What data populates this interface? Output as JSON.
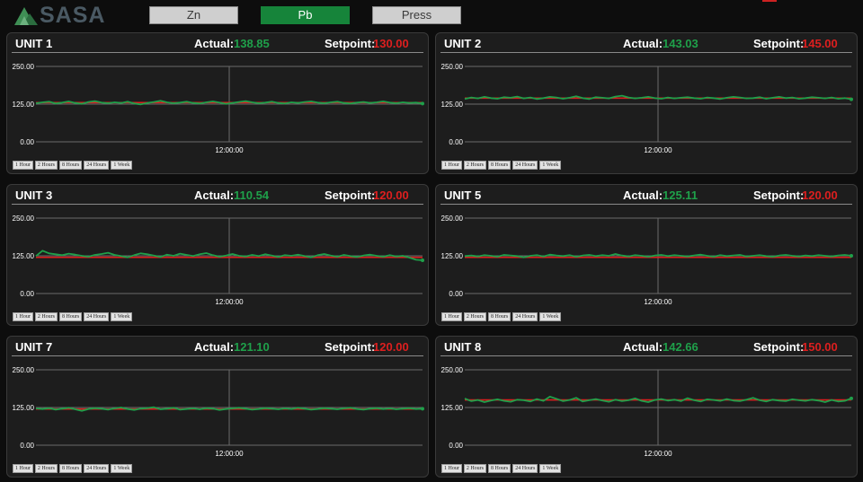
{
  "header": {
    "logo_text": "SASA",
    "tabs": [
      {
        "label": "Zn",
        "active": false
      },
      {
        "label": "Pb",
        "active": true
      },
      {
        "label": "Press",
        "active": false
      }
    ]
  },
  "labels": {
    "actual": "Actual:",
    "setpoint": "Setpoint:"
  },
  "colors": {
    "actual": "#1fa04a",
    "setpoint": "#dd1f1f",
    "active_tab": "#16843a"
  },
  "chart_common": {
    "type": "line",
    "ylim": [
      0,
      250
    ],
    "yticks": [
      "250.00",
      "125.00",
      "0.00"
    ],
    "xtick": "12:00:00",
    "grid": true
  },
  "range_buttons": [
    "1 Hour",
    "2 Hours",
    "8 Hours",
    "24 Hours",
    "1 Week"
  ],
  "units": [
    {
      "name": "UNIT 1",
      "actual": "138.85",
      "setpoint": "130.00"
    },
    {
      "name": "UNIT 2",
      "actual": "143.03",
      "setpoint": "145.00"
    },
    {
      "name": "UNIT 3",
      "actual": "110.54",
      "setpoint": "120.00"
    },
    {
      "name": "UNIT 5",
      "actual": "125.11",
      "setpoint": "120.00"
    },
    {
      "name": "UNIT 7",
      "actual": "121.10",
      "setpoint": "120.00"
    },
    {
      "name": "UNIT 8",
      "actual": "142.66",
      "setpoint": "150.00"
    }
  ],
  "chart_data": [
    {
      "type": "line",
      "title": "UNIT 1",
      "ylim": [
        0,
        250
      ],
      "series": [
        {
          "values": [
            130,
            130,
            130,
            130,
            130,
            130,
            130,
            130,
            130,
            130,
            130,
            130,
            130,
            130,
            130,
            130,
            130,
            130,
            130,
            130,
            130,
            130,
            130,
            130,
            130,
            130,
            130,
            130,
            130,
            130,
            130,
            130,
            130,
            130,
            130,
            130,
            130,
            130,
            130,
            130,
            130,
            130,
            130,
            130,
            130,
            130,
            130,
            130,
            130,
            130,
            130,
            130,
            130,
            130,
            130,
            130,
            130,
            130,
            130,
            130
          ]
        },
        {
          "values": [
            128,
            131,
            133,
            127,
            130,
            134,
            129,
            126,
            132,
            135,
            130,
            128,
            131,
            129,
            133,
            127,
            124,
            129,
            132,
            136,
            131,
            128,
            130,
            133,
            129,
            127,
            131,
            134,
            130,
            126,
            129,
            132,
            135,
            131,
            128,
            130,
            133,
            129,
            127,
            131,
            129,
            132,
            134,
            130,
            128,
            131,
            133,
            129,
            127,
            130,
            132,
            129,
            131,
            134,
            130,
            128,
            131,
            129,
            130,
            127
          ]
        }
      ]
    },
    {
      "type": "line",
      "title": "UNIT 2",
      "ylim": [
        0,
        250
      ],
      "series": [
        {
          "values": [
            145,
            145,
            145,
            145,
            145,
            145,
            145,
            145,
            145,
            145,
            145,
            145,
            145,
            145,
            145,
            145,
            145,
            145,
            145,
            145,
            145,
            145,
            145,
            145,
            145,
            145,
            145,
            145,
            145,
            145,
            145,
            145,
            145,
            145,
            145,
            145,
            145,
            145,
            145,
            145,
            145,
            145,
            145,
            145,
            145,
            145,
            145,
            145,
            145,
            145,
            145,
            145,
            145,
            145,
            145,
            145,
            145,
            145,
            145,
            145
          ]
        },
        {
          "values": [
            142,
            147,
            144,
            149,
            145,
            143,
            148,
            146,
            150,
            144,
            147,
            142,
            145,
            149,
            147,
            143,
            146,
            151,
            145,
            142,
            148,
            146,
            144,
            150,
            153,
            147,
            144,
            146,
            149,
            145,
            143,
            147,
            144,
            146,
            148,
            145,
            143,
            147,
            145,
            142,
            146,
            149,
            147,
            144,
            145,
            148,
            143,
            146,
            149,
            145,
            147,
            143,
            145,
            148,
            146,
            144,
            147,
            143,
            145,
            141
          ]
        }
      ]
    },
    {
      "type": "line",
      "title": "UNIT 3",
      "ylim": [
        0,
        250
      ],
      "series": [
        {
          "values": [
            120,
            120,
            120,
            120,
            120,
            120,
            120,
            120,
            120,
            120,
            120,
            120,
            120,
            120,
            120,
            120,
            120,
            120,
            120,
            120,
            120,
            120,
            120,
            120,
            120,
            120,
            120,
            120,
            120,
            120,
            120,
            120,
            120,
            120,
            120,
            120,
            120,
            120,
            120,
            120,
            120,
            120,
            120,
            120,
            120,
            120,
            120,
            120,
            120,
            120,
            120,
            120,
            120,
            120,
            120,
            120,
            120,
            120,
            120,
            120
          ]
        },
        {
          "values": [
            124,
            142,
            133,
            130,
            127,
            132,
            129,
            125,
            122,
            128,
            131,
            135,
            128,
            124,
            120,
            127,
            133,
            130,
            126,
            121,
            129,
            125,
            132,
            128,
            124,
            130,
            134,
            127,
            122,
            126,
            131,
            125,
            123,
            128,
            124,
            130,
            126,
            121,
            127,
            125,
            129,
            124,
            120,
            127,
            131,
            126,
            122,
            128,
            124,
            121,
            126,
            129,
            125,
            122,
            127,
            123,
            125,
            119,
            112,
            110
          ]
        }
      ]
    },
    {
      "type": "line",
      "title": "UNIT 5",
      "ylim": [
        0,
        250
      ],
      "series": [
        {
          "values": [
            120,
            120,
            120,
            120,
            120,
            120,
            120,
            120,
            120,
            120,
            120,
            120,
            120,
            120,
            120,
            120,
            120,
            120,
            120,
            120,
            120,
            120,
            120,
            120,
            120,
            120,
            120,
            120,
            120,
            120,
            120,
            120,
            120,
            120,
            120,
            120,
            120,
            120,
            120,
            120,
            120,
            120,
            120,
            120,
            120,
            120,
            120,
            120,
            120,
            120,
            120,
            120,
            120,
            120,
            120,
            120,
            120,
            120,
            120,
            120
          ]
        },
        {
          "values": [
            124,
            126,
            123,
            127,
            125,
            122,
            128,
            126,
            124,
            120,
            125,
            127,
            123,
            129,
            126,
            124,
            127,
            122,
            126,
            128,
            124,
            127,
            125,
            131,
            126,
            123,
            127,
            125,
            122,
            126,
            128,
            124,
            127,
            125,
            123,
            126,
            129,
            125,
            122,
            127,
            124,
            126,
            128,
            123,
            125,
            127,
            124,
            122,
            126,
            128,
            125,
            123,
            126,
            124,
            127,
            125,
            123,
            126,
            128,
            125
          ]
        }
      ]
    },
    {
      "type": "line",
      "title": "UNIT 7",
      "ylim": [
        0,
        250
      ],
      "series": [
        {
          "values": [
            120,
            120,
            120,
            120,
            120,
            120,
            120,
            120,
            120,
            120,
            120,
            120,
            120,
            120,
            120,
            120,
            120,
            120,
            120,
            120,
            120,
            120,
            120,
            120,
            120,
            120,
            120,
            120,
            120,
            120,
            120,
            120,
            120,
            120,
            120,
            120,
            120,
            120,
            120,
            120,
            120,
            120,
            120,
            120,
            120,
            120,
            120,
            120,
            120,
            120,
            120,
            120,
            120,
            120,
            120,
            120,
            120,
            120,
            120,
            120
          ]
        },
        {
          "values": [
            122,
            120,
            123,
            118,
            121,
            124,
            119,
            114,
            120,
            123,
            121,
            118,
            122,
            125,
            120,
            117,
            121,
            123,
            126,
            119,
            121,
            124,
            118,
            120,
            122,
            119,
            123,
            121,
            117,
            120,
            122,
            124,
            121,
            118,
            120,
            123,
            121,
            119,
            122,
            120,
            124,
            121,
            118,
            120,
            123,
            121,
            119,
            122,
            124,
            120,
            118,
            121,
            123,
            120,
            122,
            119,
            121,
            123,
            120,
            121
          ]
        }
      ]
    },
    {
      "type": "line",
      "title": "UNIT 8",
      "ylim": [
        0,
        250
      ],
      "series": [
        {
          "values": [
            150,
            150,
            150,
            150,
            150,
            150,
            150,
            150,
            150,
            150,
            150,
            150,
            150,
            150,
            150,
            150,
            150,
            150,
            150,
            150,
            150,
            150,
            150,
            150,
            150,
            150,
            150,
            150,
            150,
            150,
            150,
            150,
            150,
            150,
            150,
            150,
            150,
            150,
            150,
            150,
            150,
            150,
            150,
            150,
            150,
            150,
            150,
            150,
            150,
            150,
            150,
            150,
            150,
            150,
            150,
            150,
            150,
            150,
            150,
            150
          ]
        },
        {
          "values": [
            155,
            146,
            150,
            143,
            148,
            152,
            147,
            144,
            151,
            149,
            145,
            153,
            147,
            161,
            154,
            146,
            150,
            157,
            145,
            149,
            153,
            148,
            144,
            151,
            146,
            149,
            155,
            147,
            143,
            150,
            153,
            148,
            151,
            146,
            156,
            149,
            145,
            152,
            150,
            147,
            153,
            148,
            146,
            151,
            157,
            149,
            145,
            151,
            148,
            146,
            152,
            149,
            147,
            151,
            148,
            143,
            150,
            145,
            147,
            155
          ]
        }
      ]
    }
  ]
}
